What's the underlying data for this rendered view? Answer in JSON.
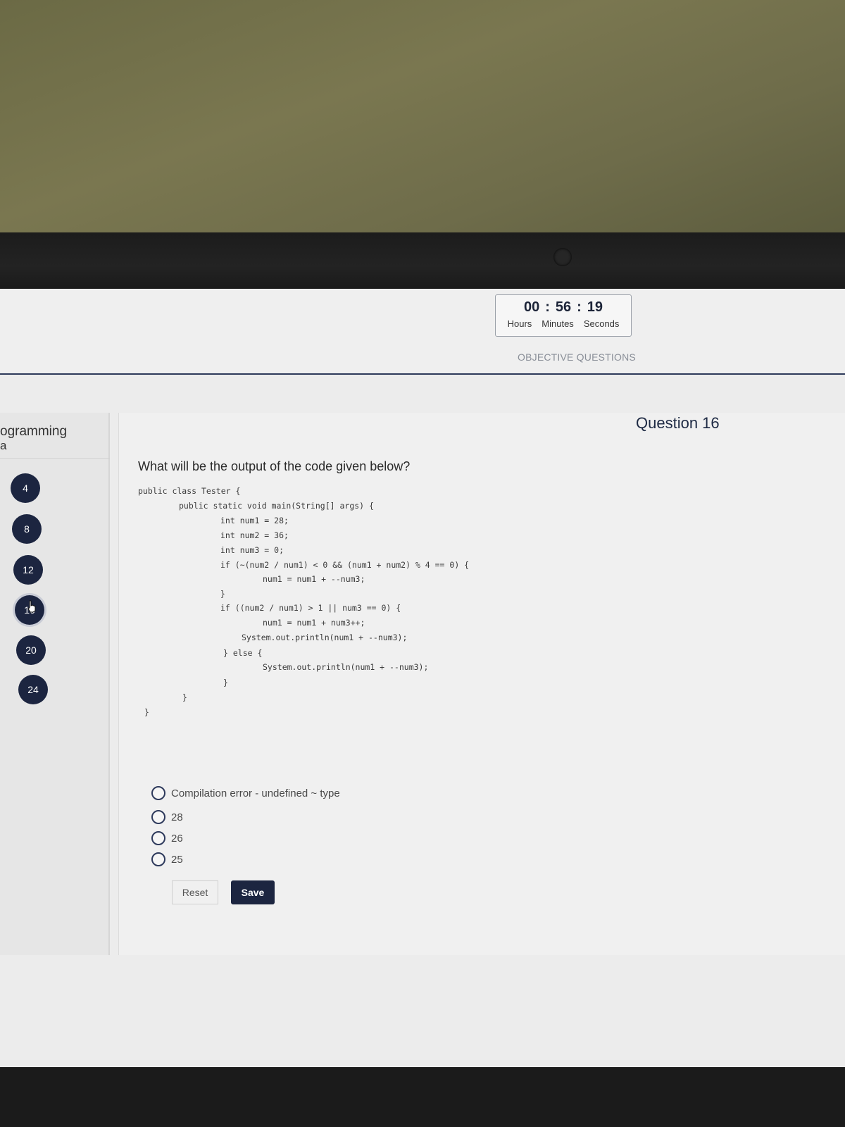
{
  "timer": {
    "hours": "00",
    "minutes": "56",
    "seconds": "19",
    "separator": ":",
    "hours_label": "Hours",
    "minutes_label": "Minutes",
    "seconds_label": "Seconds"
  },
  "header": {
    "section_title": "OBJECTIVE QUESTIONS"
  },
  "sidebar": {
    "title": "ogramming",
    "subtitle": "a",
    "questions": [
      "4",
      "8",
      "12",
      "16",
      "20",
      "24"
    ],
    "active_question": "16"
  },
  "question": {
    "number_label": "Question 16",
    "text": "What will be the output of the code given below?",
    "code": [
      "public class Tester {",
      "public static void main(String[] args) {",
      "int num1 = 28;",
      "int num2 = 36;",
      "int num3 = 0;",
      "if (~(num2 / num1) < 0 && (num1 + num2) % 4 == 0) {",
      "num1 = num1 + --num3;",
      "}",
      "if ((num2 / num1) > 1 || num3 == 0) {",
      "num1 = num1 + num3++;",
      "System.out.println(num1 + --num3);",
      "} else {",
      "System.out.println(num1 + --num3);",
      "}",
      "}",
      "}"
    ],
    "options": [
      "Compilation error - undefined ~ type",
      "28",
      "26",
      "25"
    ]
  },
  "actions": {
    "reset_label": "Reset",
    "save_label": "Save"
  },
  "colors": {
    "accent": "#1c2540",
    "header_rule": "#2d3a5a"
  }
}
